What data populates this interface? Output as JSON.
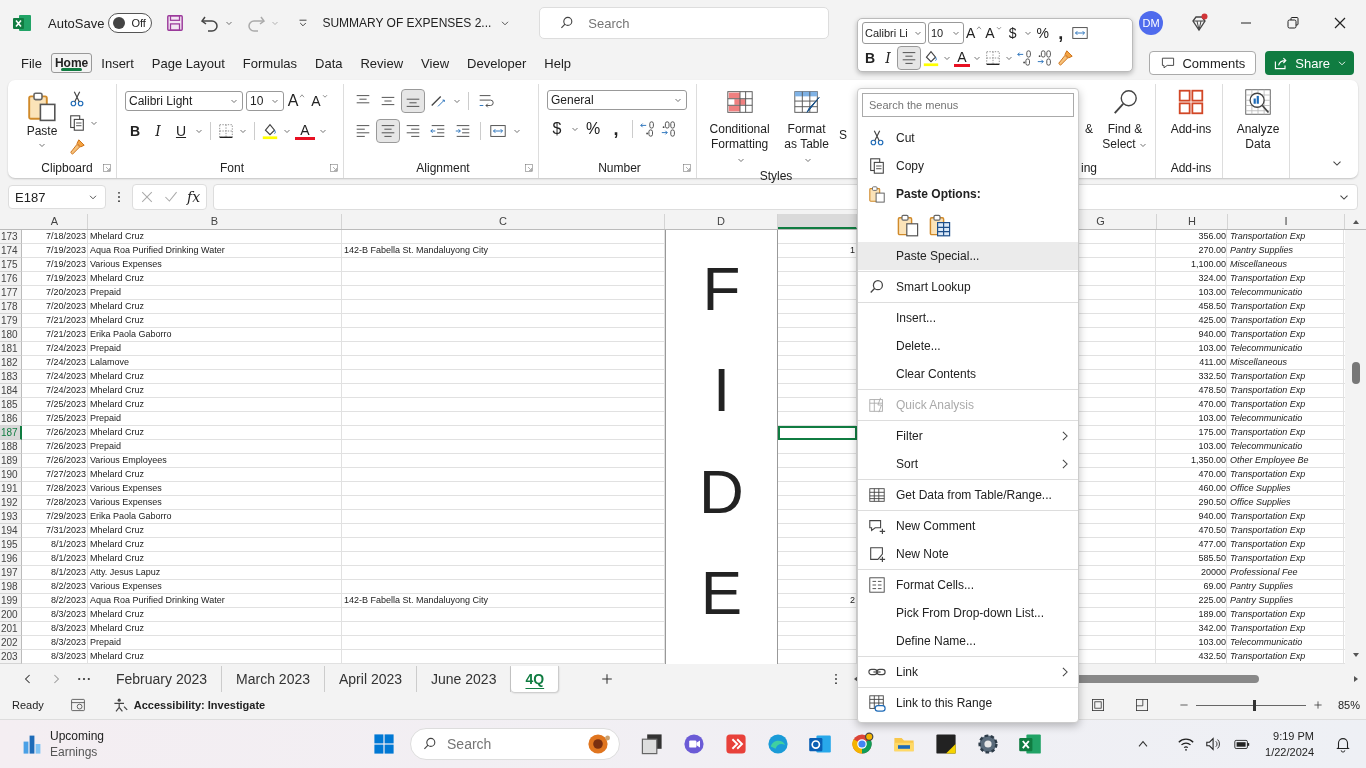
{
  "title_bar": {
    "autosave_label": "AutoSave",
    "autosave": {
      "on": false,
      "state_label": "Off"
    },
    "document_title": "SUMMARY OF EXPENSES 2...",
    "search_placeholder": "Search",
    "avatar_initials": "DM"
  },
  "menu_tabs": [
    {
      "label": "File",
      "selected": false
    },
    {
      "label": "Home",
      "selected": true
    },
    {
      "label": "Insert",
      "selected": false
    },
    {
      "label": "Page Layout",
      "selected": false
    },
    {
      "label": "Formulas",
      "selected": false
    },
    {
      "label": "Data",
      "selected": false
    },
    {
      "label": "Review",
      "selected": false
    },
    {
      "label": "View",
      "selected": false
    },
    {
      "label": "Developer",
      "selected": false
    },
    {
      "label": "Help",
      "selected": false
    }
  ],
  "comments_button": "Comments",
  "share_button": "Share",
  "ribbon": {
    "clipboard": {
      "paste": "Paste",
      "label": "Clipboard"
    },
    "font": {
      "name": "Calibri Light",
      "size": "10",
      "grow": "A",
      "shrink": "A",
      "bold": "B",
      "italic": "I",
      "underline": "U",
      "font_color": "A",
      "label": "Font"
    },
    "alignment": {
      "label": "Alignment"
    },
    "number": {
      "format": "General",
      "currency": "$",
      "percent": "%",
      "comma": ",",
      "label": "Number"
    },
    "styles": {
      "conditional_formatting": "Conditional Formatting",
      "format_as_table": "Format as Table",
      "covered_button": "S",
      "label": "Styles"
    },
    "editing": {
      "covered_button": "&",
      "find_select": "Find & Select",
      "label": "ing"
    },
    "add_ins": {
      "button": "Add-ins",
      "label": "Add-ins"
    },
    "analyze": {
      "button": "Analyze Data"
    }
  },
  "formula_bar": {
    "name_box": "E187",
    "fx": "fx"
  },
  "sheet": {
    "columns": [
      {
        "label": "A",
        "selected": false
      },
      {
        "label": "B",
        "selected": false
      },
      {
        "label": "C",
        "selected": false
      },
      {
        "label": "D",
        "selected": false
      },
      {
        "selected": true
      },
      {
        "label": "G",
        "selected": false
      },
      {
        "label": "H",
        "selected": false
      },
      {
        "label": "I",
        "selected": false
      }
    ],
    "merged_cell_letters": [
      "F",
      "I",
      "D",
      "E"
    ],
    "rows": [
      {
        "num": "173",
        "date": "7/18/2023",
        "payee": "Mhelard Cruz",
        "amount": "356.00",
        "category": "Transportation Exp",
        "selected": false
      },
      {
        "num": "174",
        "date": "7/19/2023",
        "payee": "Aqua Roa Purified Drinking Water",
        "address": "142-B Fabella St. Mandaluyong City",
        "col_e": "1",
        "amount": "270.00",
        "category": "Pantry Supplies",
        "selected": false
      },
      {
        "num": "175",
        "date": "7/19/2023",
        "payee": "Various Expenses",
        "amount": "1,100.00",
        "category": "Miscellaneous",
        "selected": false
      },
      {
        "num": "176",
        "date": "7/19/2023",
        "payee": "Mhelard Cruz",
        "amount": "324.00",
        "category": "Transportation Exp",
        "selected": false
      },
      {
        "num": "177",
        "date": "7/20/2023",
        "payee": "Prepaid",
        "amount": "103.00",
        "category": "Telecommunicatio",
        "selected": false
      },
      {
        "num": "178",
        "date": "7/20/2023",
        "payee": "Mhelard Cruz",
        "amount": "458.50",
        "category": "Transportation Exp",
        "selected": false
      },
      {
        "num": "179",
        "date": "7/21/2023",
        "payee": "Mhelard Cruz",
        "amount": "425.00",
        "category": "Transportation Exp",
        "selected": false
      },
      {
        "num": "180",
        "date": "7/21/2023",
        "payee": "Erika Paola Gaborro",
        "amount": "940.00",
        "category": "Transportation Exp",
        "selected": false
      },
      {
        "num": "181",
        "date": "7/24/2023",
        "payee": "Prepaid",
        "amount": "103.00",
        "category": "Telecommunicatio",
        "selected": false
      },
      {
        "num": "182",
        "date": "7/24/2023",
        "payee": "Lalamove",
        "amount": "411.00",
        "category": "Miscellaneous",
        "selected": false
      },
      {
        "num": "183",
        "date": "7/24/2023",
        "payee": "Mhelard Cruz",
        "amount": "332.50",
        "category": "Transportation Exp",
        "selected": false
      },
      {
        "num": "184",
        "date": "7/24/2023",
        "payee": "Mhelard Cruz",
        "amount": "478.50",
        "category": "Transportation Exp",
        "selected": false
      },
      {
        "num": "185",
        "date": "7/25/2023",
        "payee": "Mhelard Cruz",
        "amount": "470.00",
        "category": "Transportation Exp",
        "selected": false
      },
      {
        "num": "186",
        "date": "7/25/2023",
        "payee": "Prepaid",
        "amount": "103.00",
        "category": "Telecommunicatio",
        "selected": false
      },
      {
        "num": "187",
        "date": "7/26/2023",
        "payee": "Mhelard Cruz",
        "amount": "175.00",
        "category": "Transportation Exp",
        "selected": true
      },
      {
        "num": "188",
        "date": "7/26/2023",
        "payee": "Prepaid",
        "amount": "103.00",
        "category": "Telecommunicatio",
        "selected": false
      },
      {
        "num": "189",
        "date": "7/26/2023",
        "payee": "Various Employees",
        "amount": "1,350.00",
        "category": "Other Employee Be",
        "selected": false
      },
      {
        "num": "190",
        "date": "7/27/2023",
        "payee": "Mhelard Cruz",
        "amount": "470.00",
        "category": "Transportation Exp",
        "selected": false
      },
      {
        "num": "191",
        "date": "7/28/2023",
        "payee": "Various Expenses",
        "amount": "460.00",
        "category": "Office Supplies",
        "selected": false
      },
      {
        "num": "192",
        "date": "7/28/2023",
        "payee": "Various Expenses",
        "amount": "290.50",
        "category": "Office Supplies",
        "selected": false
      },
      {
        "num": "193",
        "date": "7/29/2023",
        "payee": "Erika Paola Gaborro",
        "amount": "940.00",
        "category": "Transportation Exp",
        "selected": false
      },
      {
        "num": "194",
        "date": "7/31/2023",
        "payee": "Mhelard Cruz",
        "amount": "470.50",
        "category": "Transportation Exp",
        "selected": false
      },
      {
        "num": "195",
        "date": "8/1/2023",
        "payee": "Mhelard Cruz",
        "amount": "477.00",
        "category": "Transportation Exp",
        "selected": false
      },
      {
        "num": "196",
        "date": "8/1/2023",
        "payee": "Mhelard Cruz",
        "amount": "585.50",
        "category": "Transportation Exp",
        "selected": false
      },
      {
        "num": "197",
        "date": "8/1/2023",
        "payee": "Atty. Jesus Lapuz",
        "amount": "20000",
        "category": "Professional Fee",
        "selected": false
      },
      {
        "num": "198",
        "date": "8/2/2023",
        "payee": "Various Expenses",
        "amount": "69.00",
        "category": "Pantry Supplies",
        "selected": false
      },
      {
        "num": "199",
        "date": "8/2/2023",
        "payee": "Aqua Roa Purified Drinking Water",
        "address": "142-B Fabella St. Mandaluyong City",
        "col_e": "2",
        "amount": "225.00",
        "category": "Pantry Supplies",
        "selected": false
      },
      {
        "num": "200",
        "date": "8/3/2023",
        "payee": "Mhelard Cruz",
        "amount": "189.00",
        "category": "Transportation Exp",
        "selected": false
      },
      {
        "num": "201",
        "date": "8/3/2023",
        "payee": "Mhelard Cruz",
        "amount": "342.00",
        "category": "Transportation Exp",
        "selected": false
      },
      {
        "num": "202",
        "date": "8/3/2023",
        "payee": "Prepaid",
        "amount": "103.00",
        "category": "Telecommunicatio",
        "selected": false
      },
      {
        "num": "203",
        "date": "8/3/2023",
        "payee": "Mhelard Cruz",
        "amount": "432.50",
        "category": "Transportation Exp",
        "selected": false
      }
    ]
  },
  "sheet_tabs": [
    {
      "label": "February 2023",
      "selected": false
    },
    {
      "label": "March 2023",
      "selected": false
    },
    {
      "label": "April 2023",
      "selected": false
    },
    {
      "label": "June 2023",
      "selected": false
    },
    {
      "label": "4Q",
      "selected": true
    }
  ],
  "status_bar": {
    "ready": "Ready",
    "accessibility": "Accessibility: Investigate",
    "zoom": {
      "level": 0.53
    },
    "zoom_label": "85%"
  },
  "taskbar": {
    "widget_title": "Upcoming",
    "widget_subtitle": "Earnings",
    "search_placeholder": "Search",
    "time": "9:19 PM",
    "date": "1/22/2024"
  },
  "mini_toolbar": {
    "font_name": "Calibri Li",
    "font_size": "10",
    "grow": "A",
    "shrink": "A",
    "currency": "$",
    "percent": "%",
    "comma": ",",
    "bold": "B",
    "italic": "I",
    "font_color": "A"
  },
  "context_menu": {
    "search_placeholder": "Search the menus",
    "groups": [
      [
        {
          "kind": "command",
          "label": "Cut",
          "disabled": false,
          "submenu": false,
          "highlighted": false
        },
        {
          "kind": "command",
          "label": "Copy",
          "disabled": false,
          "submenu": false,
          "highlighted": false
        },
        {
          "kind": "header",
          "label": "Paste Options:"
        },
        {
          "kind": "paste-icons"
        },
        {
          "kind": "command",
          "label": "Paste Special...",
          "disabled": false,
          "submenu": false,
          "highlighted": true
        }
      ],
      [
        {
          "kind": "command",
          "label": "Smart Lookup",
          "disabled": false,
          "submenu": false,
          "highlighted": false
        }
      ],
      [
        {
          "kind": "command",
          "label": "Insert...",
          "disabled": false,
          "submenu": false,
          "highlighted": false
        },
        {
          "kind": "command",
          "label": "Delete...",
          "disabled": false,
          "submenu": false,
          "highlighted": false
        },
        {
          "kind": "command",
          "label": "Clear Contents",
          "disabled": false,
          "submenu": false,
          "highlighted": false
        }
      ],
      [
        {
          "kind": "command",
          "label": "Quick Analysis",
          "disabled": true,
          "submenu": false,
          "highlighted": false
        }
      ],
      [
        {
          "kind": "command",
          "label": "Filter",
          "disabled": false,
          "submenu": true,
          "highlighted": false
        },
        {
          "kind": "command",
          "label": "Sort",
          "disabled": false,
          "submenu": true,
          "highlighted": false
        }
      ],
      [
        {
          "kind": "command",
          "label": "Get Data from Table/Range...",
          "disabled": false,
          "submenu": false,
          "highlighted": false
        }
      ],
      [
        {
          "kind": "command",
          "label": "New Comment",
          "disabled": false,
          "submenu": false,
          "highlighted": false
        },
        {
          "kind": "command",
          "label": "New Note",
          "disabled": false,
          "submenu": false,
          "highlighted": false
        }
      ],
      [
        {
          "kind": "command",
          "label": "Format Cells...",
          "disabled": false,
          "submenu": false,
          "highlighted": false
        },
        {
          "kind": "command",
          "label": "Pick From Drop-down List...",
          "disabled": false,
          "submenu": false,
          "highlighted": false
        },
        {
          "kind": "command",
          "label": "Define Name...",
          "disabled": false,
          "submenu": false,
          "highlighted": false
        }
      ],
      [
        {
          "kind": "command",
          "label": "Link",
          "disabled": false,
          "submenu": true,
          "highlighted": false
        }
      ],
      [
        {
          "kind": "command",
          "label": "Link to this Range",
          "disabled": false,
          "submenu": false,
          "highlighted": false
        }
      ]
    ]
  }
}
